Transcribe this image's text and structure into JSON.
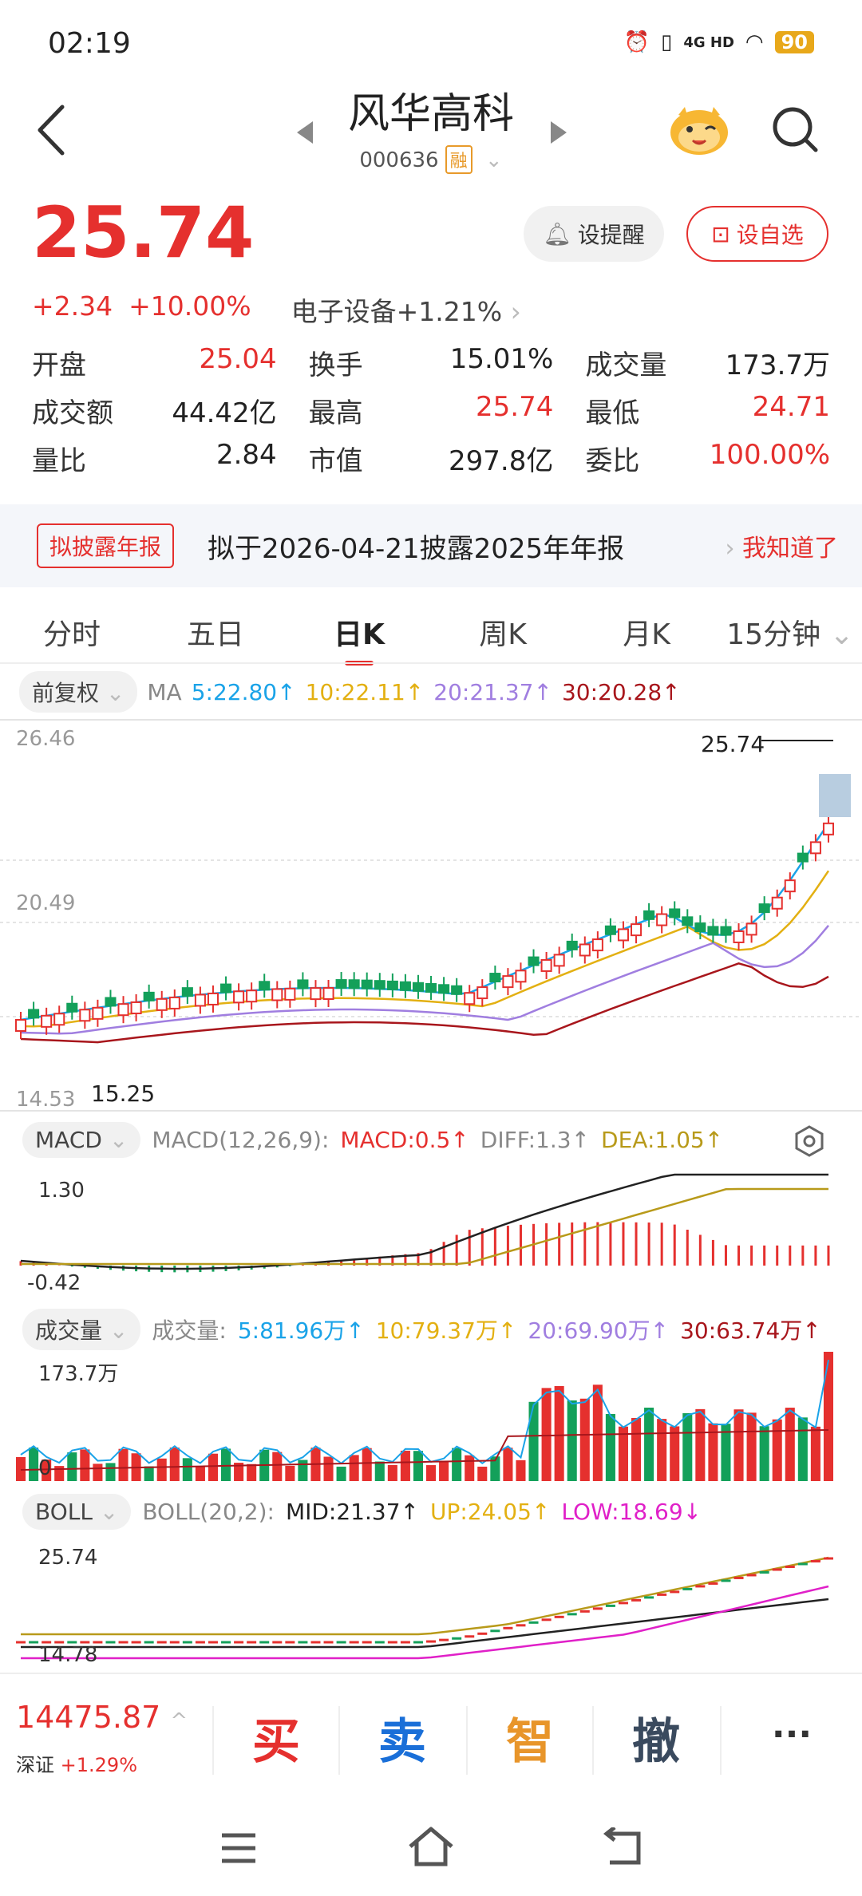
{
  "status_bar": {
    "time": "02:19",
    "network": "4G HD",
    "battery": "90"
  },
  "header": {
    "title": "风华高科",
    "code": "000636",
    "margin_tag": "融"
  },
  "quote": {
    "price": "25.74",
    "change": "+2.34",
    "change_pct": "+10.00%",
    "sector": "电子设备",
    "sector_pct": "+1.21%",
    "alert_label": "设提醒",
    "fav_label": "设自选"
  },
  "stats": [
    [
      {
        "label": "开盘",
        "value": "25.04",
        "color": "red"
      },
      {
        "label": "换手",
        "value": "15.01%",
        "color": "normal"
      },
      {
        "label": "成交量",
        "value": "173.7万",
        "color": "normal"
      }
    ],
    [
      {
        "label": "成交额",
        "value": "44.42亿",
        "color": "normal"
      },
      {
        "label": "最高",
        "value": "25.74",
        "color": "red"
      },
      {
        "label": "最低",
        "value": "24.71",
        "color": "red"
      }
    ],
    [
      {
        "label": "量比",
        "value": "2.84",
        "color": "normal"
      },
      {
        "label": "市值",
        "value": "297.8亿",
        "color": "normal"
      },
      {
        "label": "委比",
        "value": "100.00%",
        "color": "red"
      }
    ]
  ],
  "banner": {
    "tag": "拟披露年报",
    "text": "拟于2026-04-21披露2025年年报",
    "ack": "我知道了"
  },
  "tabs": [
    "分时",
    "五日",
    "日K",
    "周K",
    "月K",
    "15分钟"
  ],
  "active_tab": "日K",
  "ma_row": {
    "adjust": "前复权",
    "label": "MA",
    "ma5": "5:22.80↑",
    "ma10": "10:22.11↑",
    "ma20": "20:21.37↑",
    "ma30": "30:20.28↑"
  },
  "kline_labels": {
    "top": "26.46",
    "mid": "20.49",
    "bottom": "14.53",
    "low_marker": "15.25",
    "last_marker": "25.74"
  },
  "macd": {
    "selector": "MACD",
    "params": "MACD(12,26,9):",
    "macd": "MACD:0.5↑",
    "diff": "DIFF:1.3↑",
    "dea": "DEA:1.05↑",
    "top_label": "1.30",
    "bottom_label": "-0.42"
  },
  "volume": {
    "selector": "成交量",
    "label": "成交量:",
    "v5": "5:81.96万↑",
    "v10": "10:79.37万↑",
    "v20": "20:69.90万↑",
    "v30": "30:63.74万↑",
    "top_label": "173.7万",
    "zero_label": "0"
  },
  "boll": {
    "selector": "BOLL",
    "params": "BOLL(20,2):",
    "mid": "MID:21.37↑",
    "up": "UP:24.05↑",
    "low": "LOW:18.69↓",
    "top_label": "25.74",
    "bottom_label": "14.78"
  },
  "bottom_bar": {
    "index_value": "14475.87",
    "index_name": "深证",
    "index_pct": "+1.29%",
    "buy": "买",
    "sell": "卖",
    "smart": "智",
    "cancel": "撤",
    "more": "···"
  },
  "colors": {
    "up": "#e5302e",
    "down": "#13a05a",
    "ma5": "#1aa3e8",
    "ma10": "#e3b012",
    "ma20": "#a07ee0",
    "ma30": "#a8161c"
  }
}
